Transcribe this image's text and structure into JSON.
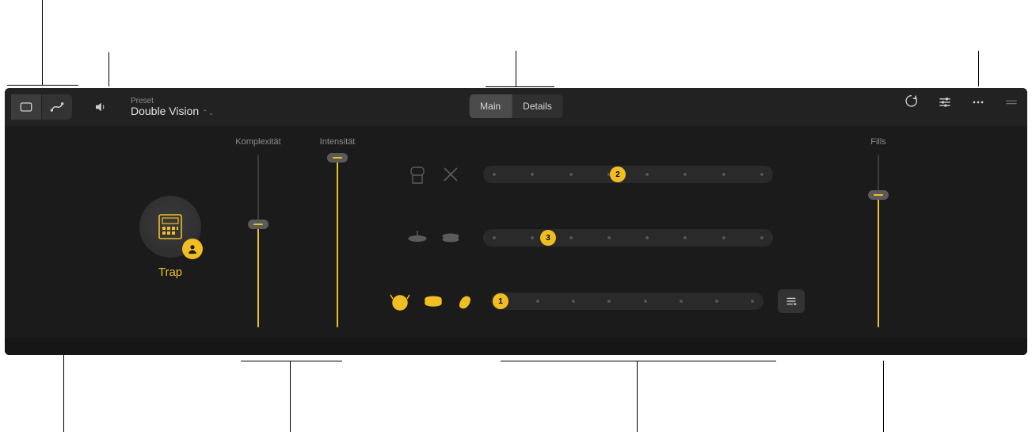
{
  "header": {
    "preset_label": "Preset",
    "preset_name": "Double Vision",
    "tabs": [
      "Main",
      "Details"
    ]
  },
  "body": {
    "genre_name": "Trap",
    "sliders": {
      "complexity": {
        "label": "Komplexität",
        "value_percent": 60
      },
      "intensity": {
        "label": "Intensität",
        "value_percent": 100
      },
      "fills": {
        "label": "Fills",
        "value_percent": 77
      }
    },
    "rows": [
      {
        "name": "percussion",
        "icons": [
          "conga",
          "sticks"
        ],
        "icons_active": [
          false,
          false
        ],
        "value": "2",
        "steps": 8
      },
      {
        "name": "hi-hat",
        "icons": [
          "cymbal",
          "hihat"
        ],
        "icons_active": [
          false,
          false
        ],
        "value": "3",
        "steps": 8
      },
      {
        "name": "kick-snare",
        "icons": [
          "kick",
          "snare",
          "clap"
        ],
        "icons_active": [
          true,
          true,
          true
        ],
        "value": "1",
        "steps": 8
      }
    ]
  }
}
